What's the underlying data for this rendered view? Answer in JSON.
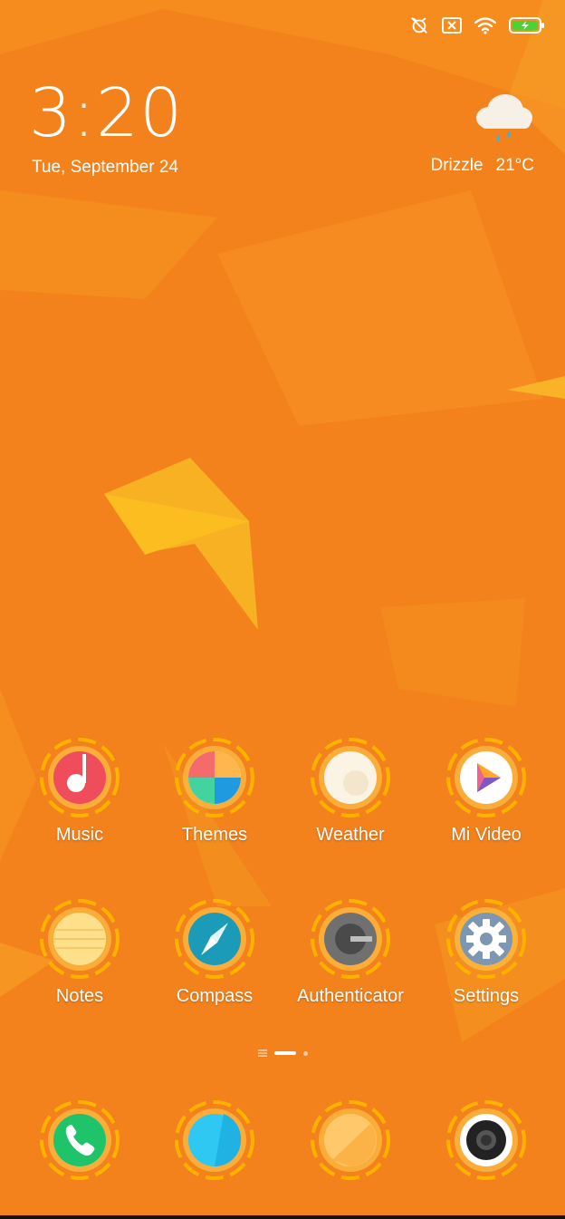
{
  "status_bar": {
    "icons": [
      "alarm-off-icon",
      "no-sim-icon",
      "wifi-icon",
      "battery-charging-icon"
    ],
    "battery_color": "#4cd137"
  },
  "lockscreen": {
    "time": "3:20",
    "date": "Tue, September 24"
  },
  "weather": {
    "condition": "Drizzle",
    "temperature": "21°C",
    "icon": "cloud-rain-icon"
  },
  "apps": [
    {
      "label": "Music",
      "icon": "music-icon"
    },
    {
      "label": "Themes",
      "icon": "themes-icon"
    },
    {
      "label": "Weather",
      "icon": "weather-app-icon"
    },
    {
      "label": "Mi Video",
      "icon": "video-play-icon"
    },
    {
      "label": "Notes",
      "icon": "notes-icon"
    },
    {
      "label": "Compass",
      "icon": "compass-icon"
    },
    {
      "label": "Authenticator",
      "icon": "authenticator-icon"
    },
    {
      "label": "Settings",
      "icon": "gear-icon"
    }
  ],
  "dock": [
    {
      "icon": "phone-icon"
    },
    {
      "icon": "messages-icon"
    },
    {
      "icon": "browser-icon"
    },
    {
      "icon": "camera-icon"
    }
  ],
  "pages": {
    "count": 2,
    "current": 1
  },
  "colors": {
    "background": "#f3821c",
    "ring": "#ffb300"
  }
}
